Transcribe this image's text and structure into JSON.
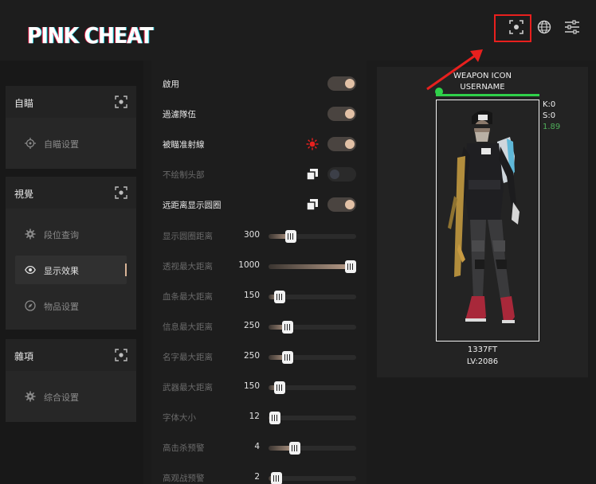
{
  "header": {
    "logo": "PINK CHEAT",
    "icons": [
      "screenshot-icon",
      "globe-icon",
      "sliders-icon"
    ]
  },
  "sidebar": {
    "sections": [
      {
        "title": "自瞄",
        "items": [
          {
            "label": "自瞄设置",
            "icon": "crosshair-icon"
          }
        ]
      },
      {
        "title": "視覺",
        "items": [
          {
            "label": "段位查询",
            "icon": "gear-icon"
          },
          {
            "label": "显示效果",
            "icon": "eye-icon",
            "active": true
          },
          {
            "label": "物品设置",
            "icon": "compass-icon"
          }
        ]
      },
      {
        "title": "雜項",
        "items": [
          {
            "label": "综合设置",
            "icon": "gear-icon"
          }
        ]
      }
    ]
  },
  "settings": {
    "toggles": [
      {
        "label": "啟用",
        "on": true
      },
      {
        "label": "過濾隊伍",
        "on": true
      },
      {
        "label": "被瞄准射線",
        "on": true,
        "icon": "sun-icon"
      },
      {
        "label": "不绘制头部",
        "on": false,
        "icon": "copy-icon"
      },
      {
        "label": "远距离显示圆圈",
        "on": true,
        "icon": "copy-icon"
      }
    ],
    "sliders": [
      {
        "label": "显示圆圈距离",
        "value": "300",
        "level": 0.25
      },
      {
        "label": "透视最大距离",
        "value": "1000",
        "level": 0.95
      },
      {
        "label": "血条最大距离",
        "value": "150",
        "level": 0.13
      },
      {
        "label": "信息最大距离",
        "value": "250",
        "level": 0.22
      },
      {
        "label": "名字最大距离",
        "value": "250",
        "level": 0.22
      },
      {
        "label": "武器最大距离",
        "value": "150",
        "level": 0.13
      },
      {
        "label": "字体大小",
        "value": "12",
        "level": 0.07
      },
      {
        "label": "高击杀预警",
        "value": "4",
        "level": 0.3
      },
      {
        "label": "高观战预警",
        "value": "2",
        "level": 0.09
      }
    ]
  },
  "preview": {
    "weapon": "WEAPON ICON",
    "username": "USERNAME",
    "kills": "K:0",
    "spectators": "S:0",
    "kd": "1.89",
    "distance": "1337FT",
    "level": "LV:2086"
  },
  "colors": {
    "accent": "#d9b497",
    "health": "#2fd14a",
    "kd_text": "#4fae5a",
    "highlight": "#e8201e"
  }
}
